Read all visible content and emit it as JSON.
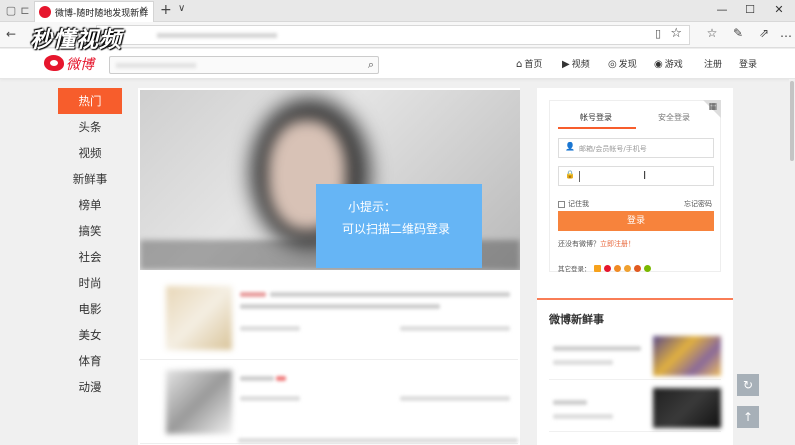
{
  "browser": {
    "tab_title": "微博-随时随地发现新鲜",
    "tab_close": "✕",
    "new_tab": "+",
    "tab_list": "∨",
    "win_min": "—",
    "win_max": "☐",
    "win_close": "✕",
    "back": "←",
    "reading_icon": "▯",
    "star_icon": "☆",
    "tools": [
      "☆",
      "✎",
      "⇗",
      "…"
    ]
  },
  "watermark": "秒懂视频",
  "header": {
    "logo_text": "微博",
    "search_icon": "⌕",
    "nav": [
      {
        "icon": "⌂",
        "label": "首页"
      },
      {
        "icon": "▶",
        "label": "视频"
      },
      {
        "icon": "◎",
        "label": "发现"
      },
      {
        "icon": "◉",
        "label": "游戏"
      },
      {
        "icon": "",
        "label": "注册"
      },
      {
        "icon": "",
        "label": "登录"
      }
    ]
  },
  "leftnav": {
    "items": [
      "热门",
      "头条",
      "视频",
      "新鲜事",
      "榜单",
      "搞笑",
      "社会",
      "时尚",
      "电影",
      "美女",
      "体育",
      "动漫"
    ],
    "active": 0
  },
  "tip": {
    "title": "小提示：",
    "body": "可以扫描二维码登录"
  },
  "login": {
    "tabs": [
      "帐号登录",
      "安全登录"
    ],
    "username_placeholder": "邮箱/会员帐号/手机号",
    "password_icon": "🔒",
    "user_icon": "👤",
    "ibeam": "I",
    "remember": "记住我",
    "forgot": "忘记密码",
    "button": "登录",
    "register_prompt": "还没有微博？",
    "register_link": "立即注册！",
    "other_login": "其它登录：",
    "social_colors": [
      "#f7a21c",
      "#e6162d",
      "#f08a24",
      "#f0a030",
      "#e05a20",
      "#7ab800"
    ],
    "qr_icon": "▦"
  },
  "fresh": {
    "title": "微博新鲜事"
  },
  "floating": {
    "refresh": "↻",
    "top": "↑"
  }
}
